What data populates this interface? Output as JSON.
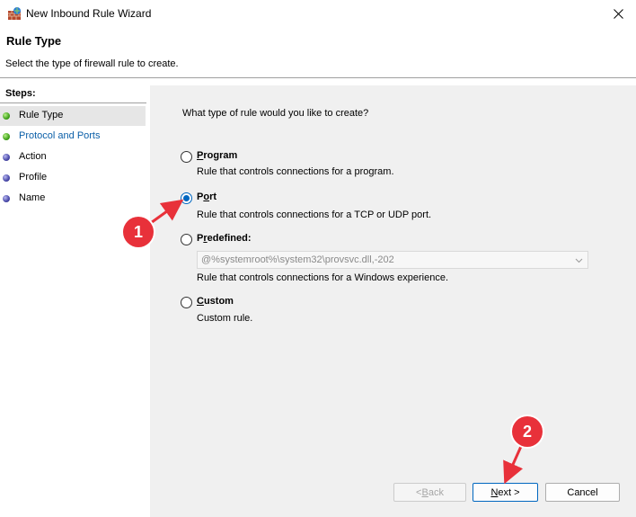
{
  "window": {
    "title": "New Inbound Rule Wizard",
    "app_icon": "firewall-icon",
    "close_icon": "close-icon"
  },
  "header": {
    "title": "Rule Type",
    "description": "Select the type of firewall rule to create."
  },
  "steps": {
    "heading": "Steps:",
    "items": [
      {
        "label": "Rule Type",
        "state": "active"
      },
      {
        "label": "Protocol and Ports",
        "state": "link"
      },
      {
        "label": "Action",
        "state": "pending"
      },
      {
        "label": "Profile",
        "state": "pending"
      },
      {
        "label": "Name",
        "state": "pending"
      }
    ]
  },
  "main": {
    "question": "What type of rule would you like to create?",
    "options": {
      "program": {
        "label_pre": "",
        "label_ul": "P",
        "label_post": "rogram",
        "description": "Rule that controls connections for a program.",
        "checked": false
      },
      "port": {
        "label_pre": "P",
        "label_ul": "o",
        "label_post": "rt",
        "description": "Rule that controls connections for a TCP or UDP port.",
        "checked": true
      },
      "predefined": {
        "label_pre": "P",
        "label_ul": "r",
        "label_post": "edefined:",
        "select_value": "@%systemroot%\\system32\\provsvc.dll,-202",
        "description": "Rule that controls connections for a Windows experience.",
        "checked": false
      },
      "custom": {
        "label_pre": "",
        "label_ul": "C",
        "label_post": "ustom",
        "description": "Custom rule.",
        "checked": false
      }
    }
  },
  "buttons": {
    "back": {
      "pre": "< ",
      "ul": "B",
      "post": "ack"
    },
    "next": {
      "pre": "",
      "ul": "N",
      "post": "ext >"
    },
    "cancel": "Cancel"
  },
  "annotations": {
    "badge1": "1",
    "badge2": "2",
    "color": "#e8313a"
  }
}
